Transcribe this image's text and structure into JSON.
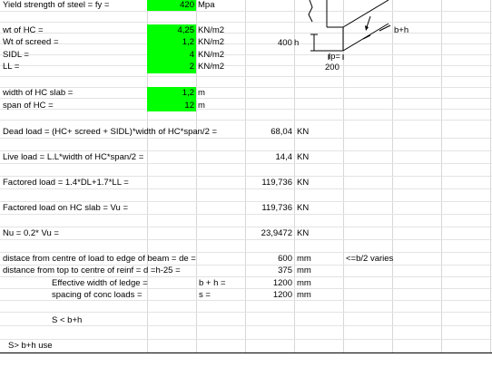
{
  "sheet": {
    "fy": {
      "label": "Yield strength of steel = fy =",
      "value": "420",
      "unit": "Mpa"
    },
    "loads": [
      {
        "label": "wt of HC =",
        "value": "4,25",
        "unit": "KN/m2"
      },
      {
        "label": "Wt of screed =",
        "value": "1,2",
        "unit": "KN/m2"
      },
      {
        "label": "SIDL =",
        "value": "4",
        "unit": "KN/m2"
      },
      {
        "label": "LL =",
        "value": "2",
        "unit": "KN/m2"
      }
    ],
    "geom": [
      {
        "label": "width of HC slab =",
        "value": "1,2",
        "unit": "m"
      },
      {
        "label": "span of HC =",
        "value": "12",
        "unit": "m"
      }
    ],
    "calcs": [
      {
        "label": "Dead load = (HC+ screed + SIDL)*width of HC*span/2 =",
        "value": "68,04",
        "unit": "KN"
      },
      {
        "label": "Live load = L.L*width of HC*span/2 =",
        "value": "14,4",
        "unit": "KN"
      },
      {
        "label": "Factored load  = 1.4*DL+1.7*LL =",
        "value": "119,736",
        "unit": "KN"
      },
      {
        "label": "Factored load on HC slab = Vu =",
        "value": "119,736",
        "unit": "KN"
      },
      {
        "label": "Nu = 0.2* Vu =",
        "value": "23,9472",
        "unit": "KN"
      }
    ],
    "distances": [
      {
        "label": "distace from centre of load to edge of beam = de =",
        "value": "600",
        "unit": "mm",
        "note": "<=b/2 varies"
      },
      {
        "label": "distance from top to centre of reinf = d =h-25 =",
        "value": "375",
        "unit": "mm"
      }
    ],
    "ledge": [
      {
        "label": "Effective width of ledge =",
        "expr": "b + h =",
        "value": "1200",
        "unit": "mm"
      },
      {
        "label": "spacing of conc loads =",
        "expr": "s =",
        "value": "1200",
        "unit": "mm"
      }
    ],
    "s_lt": "S < b+h",
    "s_gt": "S> b+h use"
  },
  "sketch": {
    "h_dim": "400",
    "h_label": "h",
    "bh_label": "b+h",
    "lp_label": "lp=",
    "lp_value": "200"
  }
}
